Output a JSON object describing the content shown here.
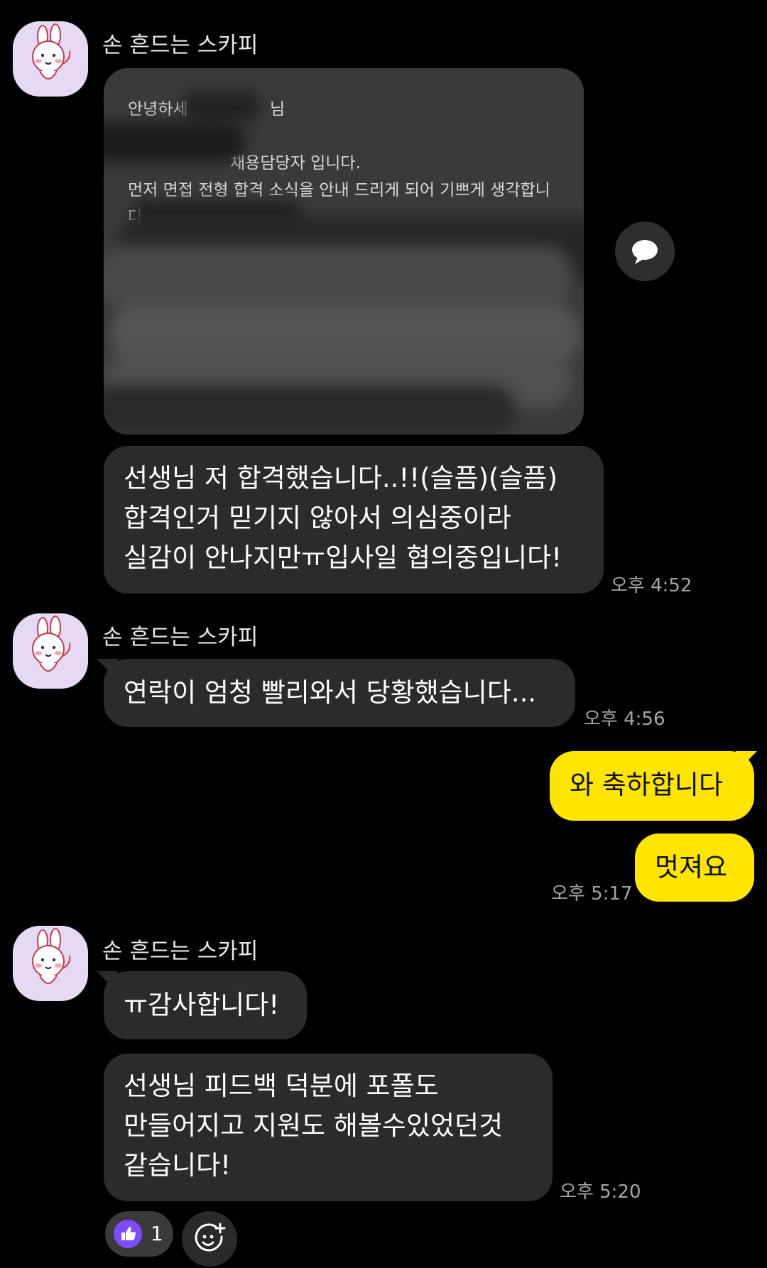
{
  "sender_name": "손 흔드는 스카피",
  "card": {
    "lines": [
      "안녕하세",
      "님",
      "채용담당자 입니다.",
      "먼저 면접 전형 합격 소식을 안내 드리게 되어 기쁘게 생각합니",
      "다"
    ]
  },
  "messages": {
    "m1": {
      "lines": [
        "선생님 저 합격했습니다..!!(슬픔)(슬픔)",
        "합격인거 믿기지 않아서 의심중이라",
        "실감이 안나지만ㅠ입사일 협의중입니다!"
      ],
      "time": "오후 4:52"
    },
    "m2": {
      "text": "연락이 엄청 빨리와서 당황했습니다...",
      "time": "오후 4:56"
    },
    "m3": {
      "text": "와 축하합니다"
    },
    "m4": {
      "text": "멋져요",
      "time": "오후 5:17"
    },
    "m5": {
      "text": "ㅠ감사합니다!"
    },
    "m6": {
      "lines": [
        "선생님 피드백 덕분에 포폴도",
        "만들어지고 지원도 해볼수있었던것",
        "같습니다!"
      ],
      "time": "오후 5:20"
    }
  },
  "reaction": {
    "icon": "thumbs-up-icon",
    "count": "1"
  },
  "add_reaction_icon": "add-emoji-icon",
  "colors": {
    "background": "#000000",
    "bubble_other": "#2b2b2b",
    "bubble_me": "#fee500",
    "avatar_bg": "#e6d9f2",
    "reaction_accent": "#7c4dff"
  }
}
